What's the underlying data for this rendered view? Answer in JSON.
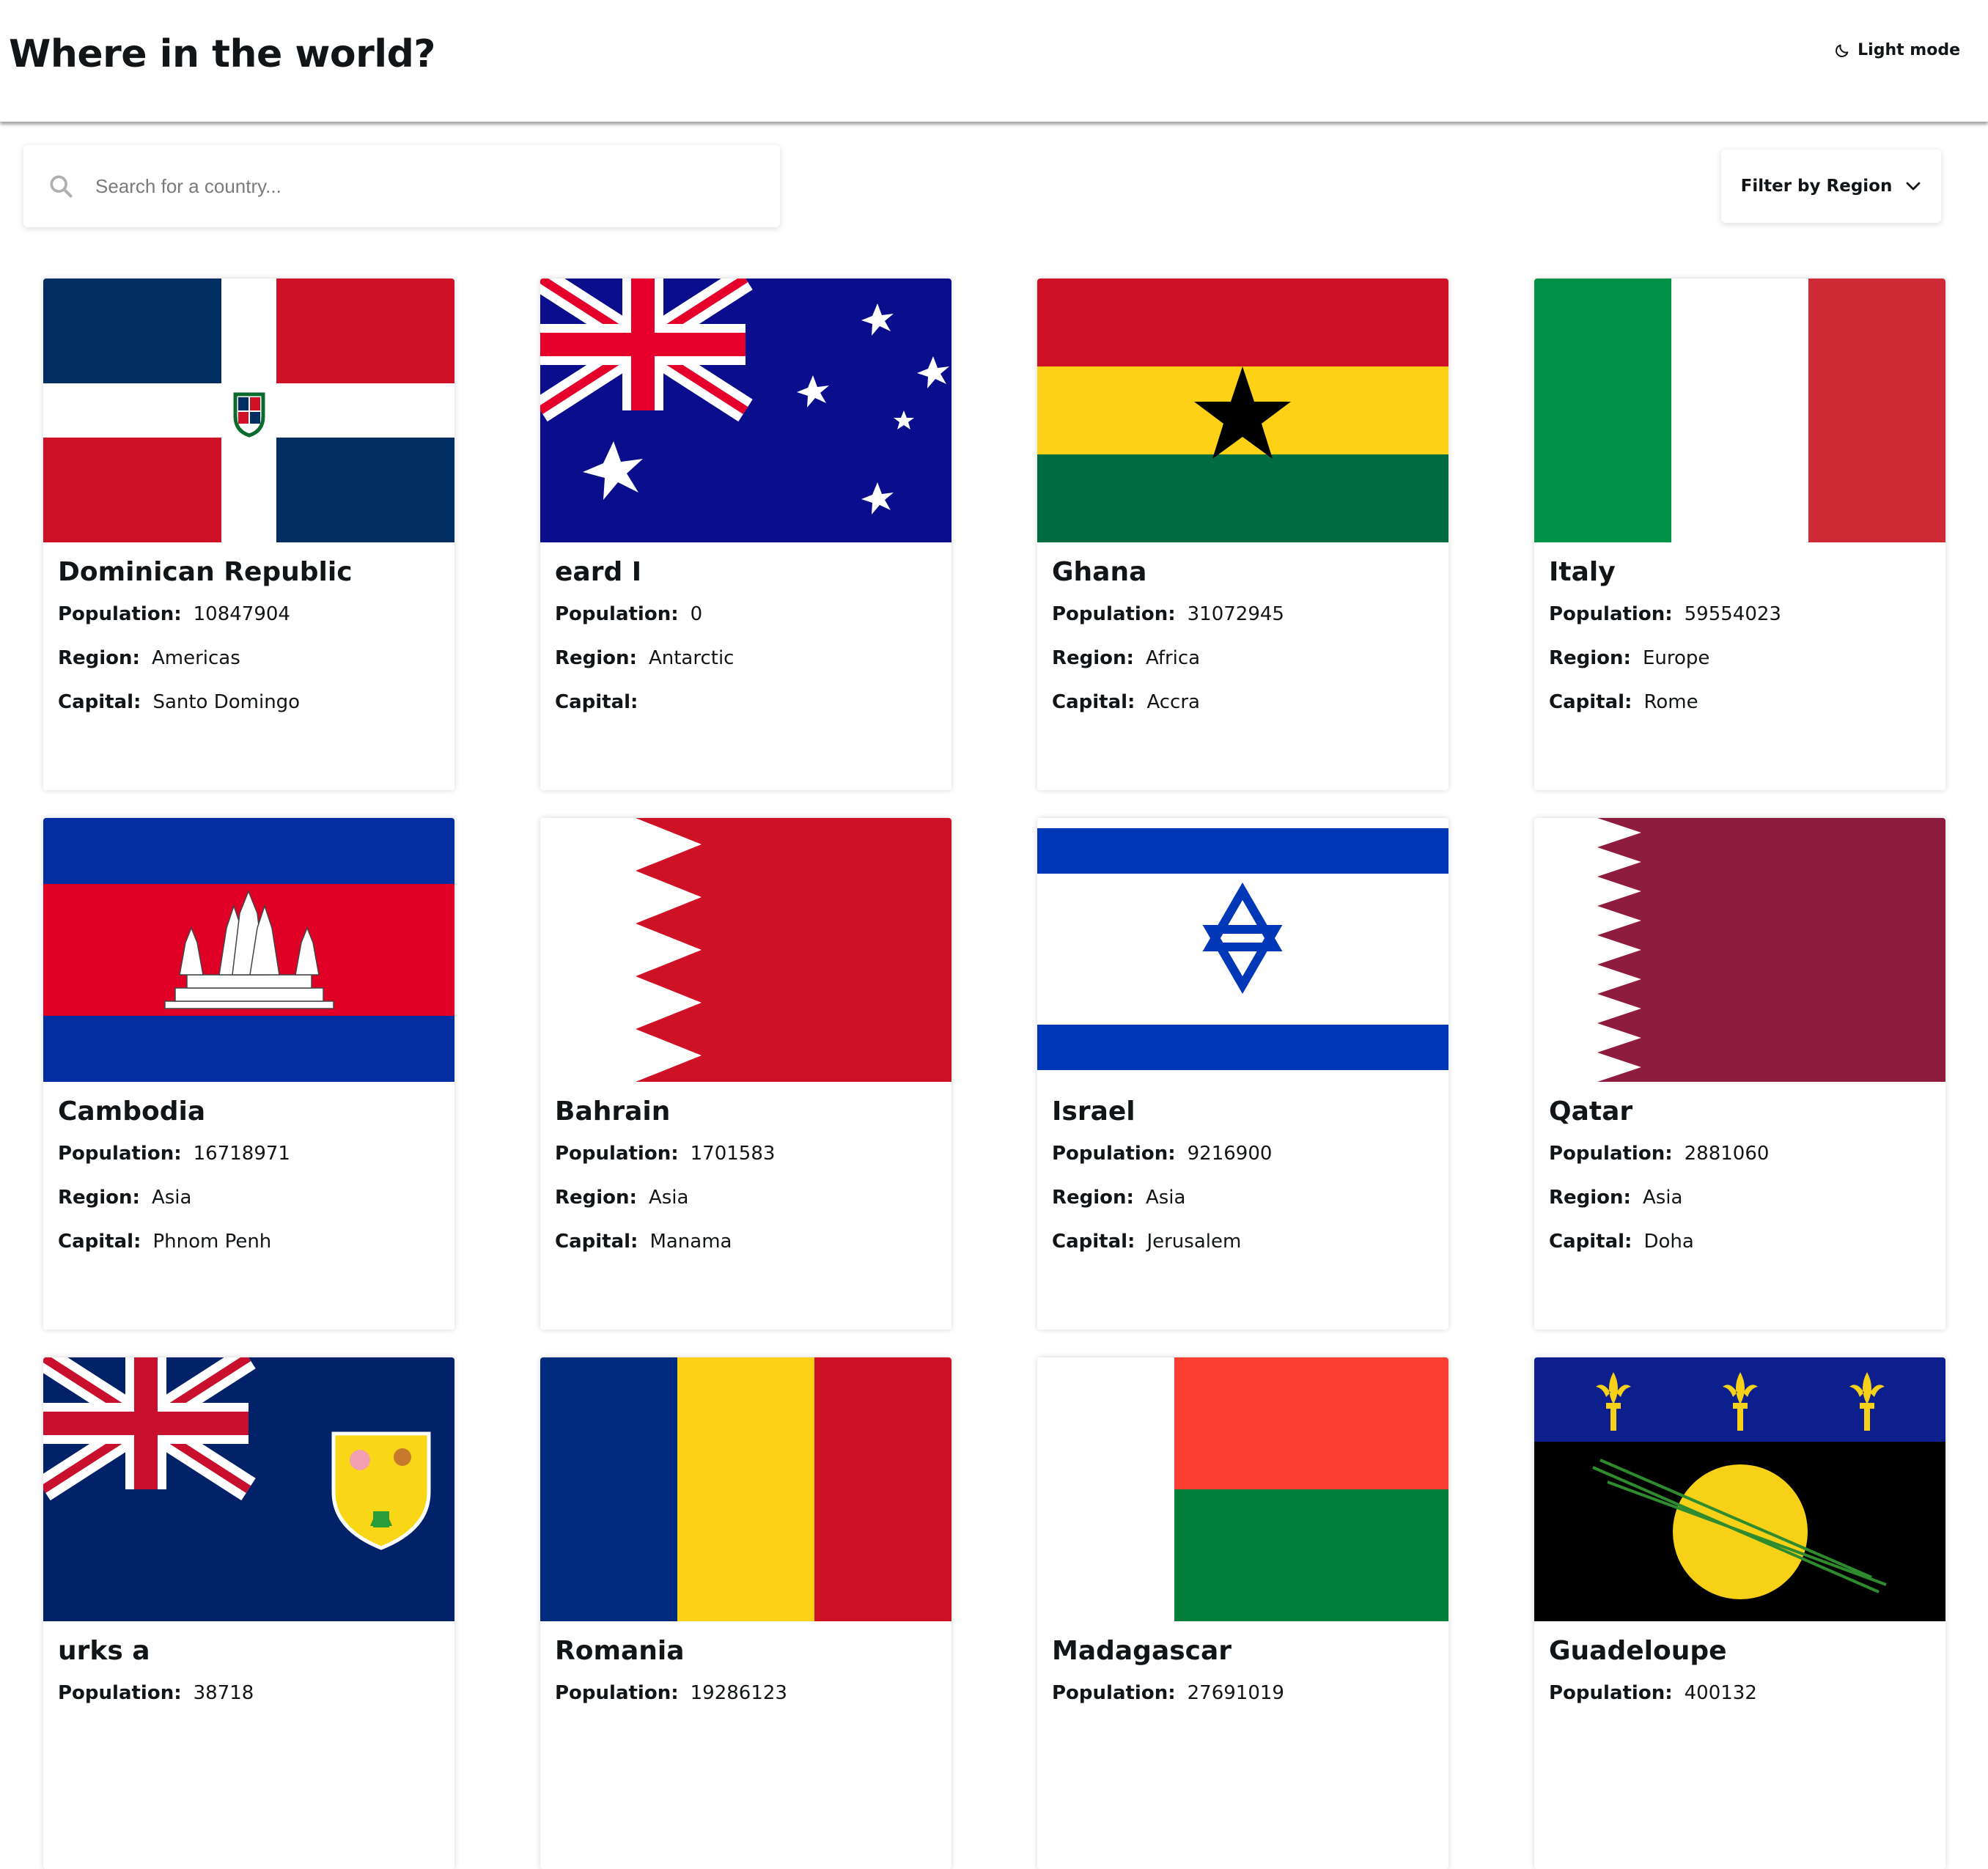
{
  "header": {
    "title": "Where in the world?",
    "theme_toggle_label": "Light mode",
    "theme_toggle_icon": "moon-icon"
  },
  "search": {
    "placeholder": "Search for a country...",
    "value": "",
    "icon": "search-icon"
  },
  "filter": {
    "label": "Filter by Region",
    "icon": "chevron-down-icon"
  },
  "labels": {
    "population": "Population:",
    "region": "Region:",
    "capital": "Capital:"
  },
  "countries": [
    {
      "name": "Dominican Republic",
      "population": "10847904",
      "region": "Americas",
      "capital": "Santo Domingo"
    },
    {
      "name": "eard I",
      "population": "0",
      "region": "Antarctic",
      "capital": ""
    },
    {
      "name": "Ghana",
      "population": "31072945",
      "region": "Africa",
      "capital": "Accra"
    },
    {
      "name": "Italy",
      "population": "59554023",
      "region": "Europe",
      "capital": "Rome"
    },
    {
      "name": "Cambodia",
      "population": "16718971",
      "region": "Asia",
      "capital": "Phnom Penh"
    },
    {
      "name": "Bahrain",
      "population": "1701583",
      "region": "Asia",
      "capital": "Manama"
    },
    {
      "name": "Israel",
      "population": "9216900",
      "region": "Asia",
      "capital": "Jerusalem"
    },
    {
      "name": "Qatar",
      "population": "2881060",
      "region": "Asia",
      "capital": "Doha"
    },
    {
      "name": "urks a",
      "population": "38718",
      "region": "",
      "capital": ""
    },
    {
      "name": "Romania",
      "population": "19286123",
      "region": "",
      "capital": ""
    },
    {
      "name": "Madagascar",
      "population": "27691019",
      "region": "",
      "capital": ""
    },
    {
      "name": "Guadeloupe",
      "population": "400132",
      "region": "",
      "capital": ""
    }
  ],
  "colors": {
    "background": "#ffffff",
    "text": "#111517",
    "header_shadow": "#888888"
  }
}
